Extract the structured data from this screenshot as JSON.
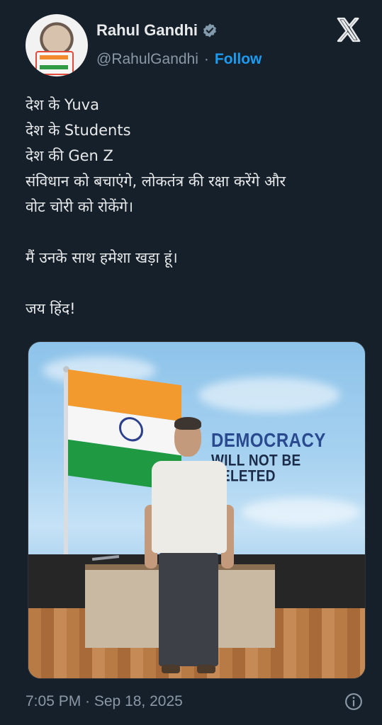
{
  "author": {
    "name": "Rahul Gandhi",
    "handle": "@RahulGandhi",
    "separator": "·",
    "follow_label": "Follow"
  },
  "tweet": {
    "text": "देश के Yuva\nदेश के Students\nदेश की Gen Z\nसंविधान को बचाएंगे, लोकतंत्र की रक्षा करेंगे और\nवोट चोरी को रोकेंगे।\n\nमैं उनके साथ हमेशा खड़ा हूं।\n\nजय हिंद!"
  },
  "media": {
    "slogan_line1": "DEMOCRACY",
    "slogan_line2": "WILL NOT BE DELETED"
  },
  "footer": {
    "timestamp": "7:05 PM · Sep 18, 2025"
  },
  "icons": {
    "verified": "verified-badge-icon",
    "platform": "x-logo-icon",
    "info": "info-icon"
  },
  "colors": {
    "background": "#15202b",
    "text": "#e7e9ea",
    "secondary_text": "#8b98a5",
    "accent": "#1d9bf0"
  }
}
